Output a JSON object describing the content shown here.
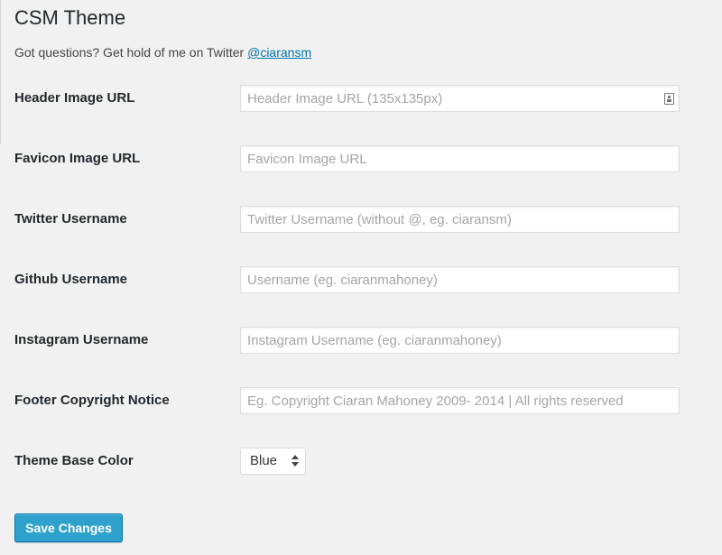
{
  "page": {
    "title": "CSM Theme",
    "intro_text": "Got questions? Get hold of me on Twitter ",
    "intro_link": "@ciaransm"
  },
  "fields": [
    {
      "label": "Header Image URL",
      "placeholder": "Header Image URL (135x135px)",
      "value": ""
    },
    {
      "label": "Favicon Image URL",
      "placeholder": "Favicon Image URL",
      "value": ""
    },
    {
      "label": "Twitter Username",
      "placeholder": "Twitter Username (without @, eg. ciaransm)",
      "value": ""
    },
    {
      "label": "Github Username",
      "placeholder": "Username (eg. ciaranmahoney)",
      "value": ""
    },
    {
      "label": "Instagram Username",
      "placeholder": "Instagram Username (eg. ciaranmahoney)",
      "value": ""
    },
    {
      "label": "Footer Copyright Notice",
      "placeholder": "Eg. Copyright Ciaran Mahoney 2009- 2014 | All rights reserved",
      "value": ""
    }
  ],
  "theme_color": {
    "label": "Theme Base Color",
    "selected": "Blue"
  },
  "save_button": {
    "label": "Save Changes"
  },
  "icons": {
    "header_field_icon": "contact-card-icon"
  },
  "colors": {
    "background": "#f1f1f1",
    "link": "#0073aa",
    "button": "#2ea2cc",
    "button_border": "#0073aa",
    "placeholder": "#a5a5a5"
  }
}
